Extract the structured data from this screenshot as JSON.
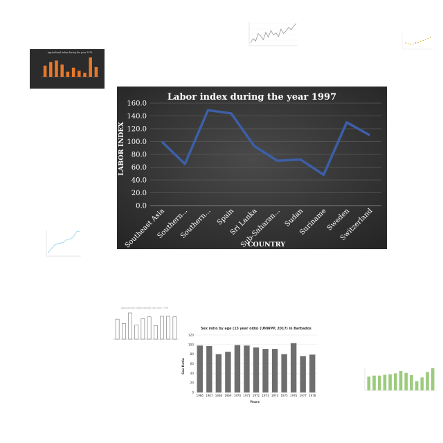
{
  "chart_data": [
    {
      "type": "line",
      "title": "Labor index during the year 1997",
      "xlabel": "COUNTRY",
      "ylabel": "LABOR INDEX",
      "categories": [
        "Southeast Asia",
        "Southern...",
        "Southern...",
        "Spain",
        "Sri Lanka",
        "Sub-Saharan...",
        "Sudan",
        "Suriname",
        "Sweden",
        "Switzerland"
      ],
      "values": [
        100,
        65,
        149,
        144,
        93,
        70,
        72,
        48,
        130,
        110
      ],
      "ylim": [
        0,
        160
      ],
      "yticks": [
        "0.0",
        "20.0",
        "40.0",
        "60.0",
        "80.0",
        "100.0",
        "120.0",
        "140.0",
        "160.0"
      ],
      "grid": true,
      "colors": {
        "background": "#3a3a3a",
        "line": "#3d5fa8",
        "text": "#ffffff"
      }
    },
    {
      "type": "bar",
      "title": "Sex ratio by age (15 year olds) (UNWPP, 2017) in Barbados",
      "xlabel": "Years",
      "ylabel": "Sex Ratio",
      "categories": [
        "1966",
        "1967",
        "1968",
        "1969",
        "1970",
        "1971",
        "1972",
        "1973",
        "1974",
        "1975",
        "1976",
        "1977",
        "1978"
      ],
      "values": [
        98,
        97,
        80,
        85,
        99,
        98,
        94,
        91,
        91,
        80,
        103,
        76,
        79
      ],
      "ylim": [
        0,
        120
      ],
      "yticks": [
        "0",
        "20",
        "40",
        "60",
        "80",
        "100",
        "120"
      ],
      "grid": true,
      "colors": {
        "bar": "#6e6e6e"
      }
    },
    {
      "type": "bar",
      "title": "Agricultural index during the year 1978",
      "values": [
        55,
        72,
        80,
        60,
        25,
        45,
        30,
        20,
        95,
        48
      ],
      "colors": {
        "bar": "#e8782a",
        "background": "#2b2b2b"
      }
    },
    {
      "type": "bar",
      "title": "Agricultural index during the year 1996",
      "values": [
        70,
        55,
        92,
        50,
        72,
        78,
        48,
        80,
        80,
        78
      ],
      "colors": {
        "bar": "#ffffff",
        "edge": "#555555"
      }
    },
    {
      "type": "bar",
      "values": [
        30,
        32,
        32,
        34,
        35,
        37,
        42,
        38,
        33,
        20,
        28,
        40,
        48
      ],
      "colors": {
        "bar": "#9ccb7e"
      }
    },
    {
      "type": "line",
      "values": [
        55,
        62,
        58,
        70,
        66,
        60,
        72,
        64,
        75,
        68,
        71,
        65,
        77,
        70,
        74,
        80,
        76,
        82,
        86
      ],
      "colors": {
        "line": "#888888"
      }
    },
    {
      "type": "line",
      "values": [
        40,
        38,
        36,
        37,
        40,
        41,
        44,
        47,
        50,
        53,
        56
      ],
      "colors": {
        "line": "#c9a300"
      }
    },
    {
      "type": "line",
      "values": [
        10,
        25,
        38,
        45,
        47,
        50,
        60,
        62,
        68,
        88,
        90
      ],
      "colors": {
        "line": "#8fd0e6"
      }
    }
  ]
}
